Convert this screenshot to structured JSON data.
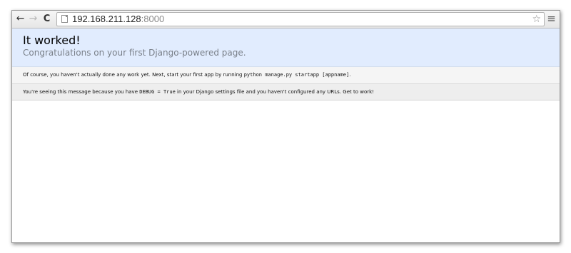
{
  "browser": {
    "url_host": "192.168.211.128",
    "url_port": ":8000",
    "back_icon": "back-arrow-icon",
    "forward_icon": "forward-arrow-icon",
    "reload_icon": "reload-icon",
    "star_icon": "star-icon",
    "menu_icon": "menu-icon"
  },
  "page": {
    "title": "It worked!",
    "subtitle": "Congratulations on your first Django-powered page.",
    "message1": {
      "text": "Of course, you haven't actually done any work yet. Next, start your first app by running ",
      "code1": "python manage.py startapp [appname]",
      "end": "."
    },
    "message2": {
      "text": "You're seeing this message because you have ",
      "code1": "DEBUG = True",
      "middle": " in your Django settings file and you haven't configured any URLs. Get to work!"
    }
  },
  "colors": {
    "header_bg": "#e1ecfe",
    "row1_bg": "#f5f5f5",
    "row2_bg": "#eeeeee"
  }
}
